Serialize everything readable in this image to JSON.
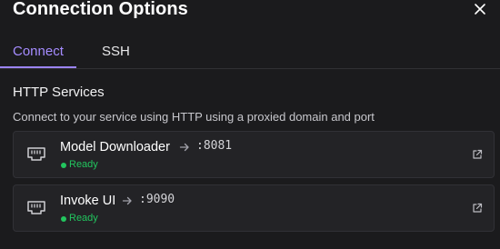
{
  "dialog": {
    "title": "Connection Options"
  },
  "tabs": [
    {
      "label": "Connect",
      "active": true
    },
    {
      "label": "SSH",
      "active": false
    }
  ],
  "section": {
    "title": "HTTP Services",
    "description": "Connect to your service using HTTP using a proxied domain and port"
  },
  "services": [
    {
      "name": "Model Downloader",
      "port": ":8081",
      "status": "Ready"
    },
    {
      "name": "Invoke UI",
      "port": ":9090",
      "status": "Ready"
    }
  ],
  "icons": {
    "close": "close-icon",
    "service": "ethernet-icon",
    "arrow": "arrow-right-icon",
    "external": "external-link-icon"
  },
  "colors": {
    "background": "#1b1b1d",
    "accent": "#9b84f6",
    "status_ready": "#22c55e",
    "card_background": "#232326"
  }
}
